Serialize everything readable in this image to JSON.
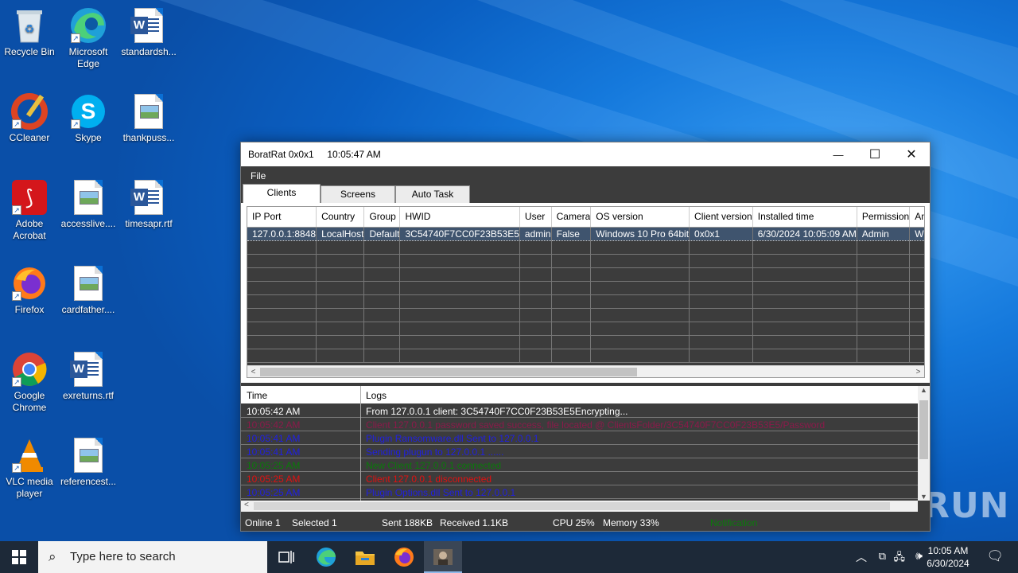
{
  "desktop": {
    "icons": [
      {
        "label": "Recycle Bin"
      },
      {
        "label": "Microsoft Edge"
      },
      {
        "label": "standardsh..."
      },
      {
        "label": "CCleaner"
      },
      {
        "label": "Skype"
      },
      {
        "label": "thankpuss..."
      },
      {
        "label": "Adobe Acrobat"
      },
      {
        "label": "accesslive...."
      },
      {
        "label": "timesapr.rtf"
      },
      {
        "label": "Firefox"
      },
      {
        "label": "cardfather...."
      },
      {
        "label": "Google Chrome"
      },
      {
        "label": "exreturns.rtf"
      },
      {
        "label": "VLC media player"
      },
      {
        "label": "referencest..."
      }
    ]
  },
  "window": {
    "title": "BoratRat 0x0x1     10:05:47 AM",
    "minimize": "—",
    "maximize": "☐",
    "close": "✕",
    "menu": {
      "file": "File"
    },
    "tabs": [
      {
        "label": "Clients"
      },
      {
        "label": "Screens"
      },
      {
        "label": "Auto Task"
      }
    ],
    "clients": {
      "columns": [
        "IP Port",
        "Country",
        "Group",
        "HWID",
        "User",
        "Camera",
        "OS version",
        "Client version",
        "Installed time",
        "Permission",
        "Anti-virus"
      ],
      "rows": [
        [
          "127.0.0.1:8848",
          "LocalHost",
          "Default",
          "3C54740F7CC0F23B53E5",
          "admin",
          "False",
          "Windows 10 Pro 64bit",
          "0x0x1",
          "6/30/2024 10:05:09 AM",
          "Admin",
          "Windows Defender"
        ]
      ],
      "scroll_left": "<",
      "scroll_right": ">"
    },
    "logs": {
      "time_header": "Time",
      "logs_header": "Logs",
      "entries": [
        {
          "time": "10:05:42 AM",
          "msg": "From 127.0.0.1 client: 3C54740F7CC0F23B53E5Encrypting...",
          "color": "#ffffff"
        },
        {
          "time": "10:05:42 AM",
          "msg": "Client 127.0.0.1 password saved success, file located @ ClientsFolder/3C54740F7CC0F23B53E5/Password",
          "color": "#8b1a4a"
        },
        {
          "time": "10:05:41 AM",
          "msg": "Plugin Ransomware.dll Sent to 127.0.0.1",
          "color": "#2020e0"
        },
        {
          "time": "10:05:41 AM",
          "msg": "Sending plugun to 127.0.0.1 ......",
          "color": "#2020e0"
        },
        {
          "time": "10:05:25 AM",
          "msg": "New Client 127.0.0.1 connected",
          "color": "#0a7a0a"
        },
        {
          "time": "10:05:25 AM",
          "msg": "Client 127.0.0.1 disconnected",
          "color": "#e01010"
        },
        {
          "time": "10:05:25 AM",
          "msg": "Plugin Options.dll Sent to 127.0.0.1",
          "color": "#2020e0"
        }
      ]
    },
    "status": {
      "online": "Online 1",
      "selected": "Selected 1",
      "sent": "Sent 188KB",
      "received": "Received  1.1KB",
      "cpu": "CPU 25%",
      "memory": "Memory 33%",
      "notification": "Notification"
    }
  },
  "watermark": "ANY RUN",
  "taskbar": {
    "search_placeholder": "Type here to search",
    "time": "10:05 AM",
    "date": "6/30/2024"
  },
  "colors": {
    "desktop": "#0a6fd4",
    "window_bg": "#3c3c3c",
    "taskbar": "#1d2938"
  }
}
